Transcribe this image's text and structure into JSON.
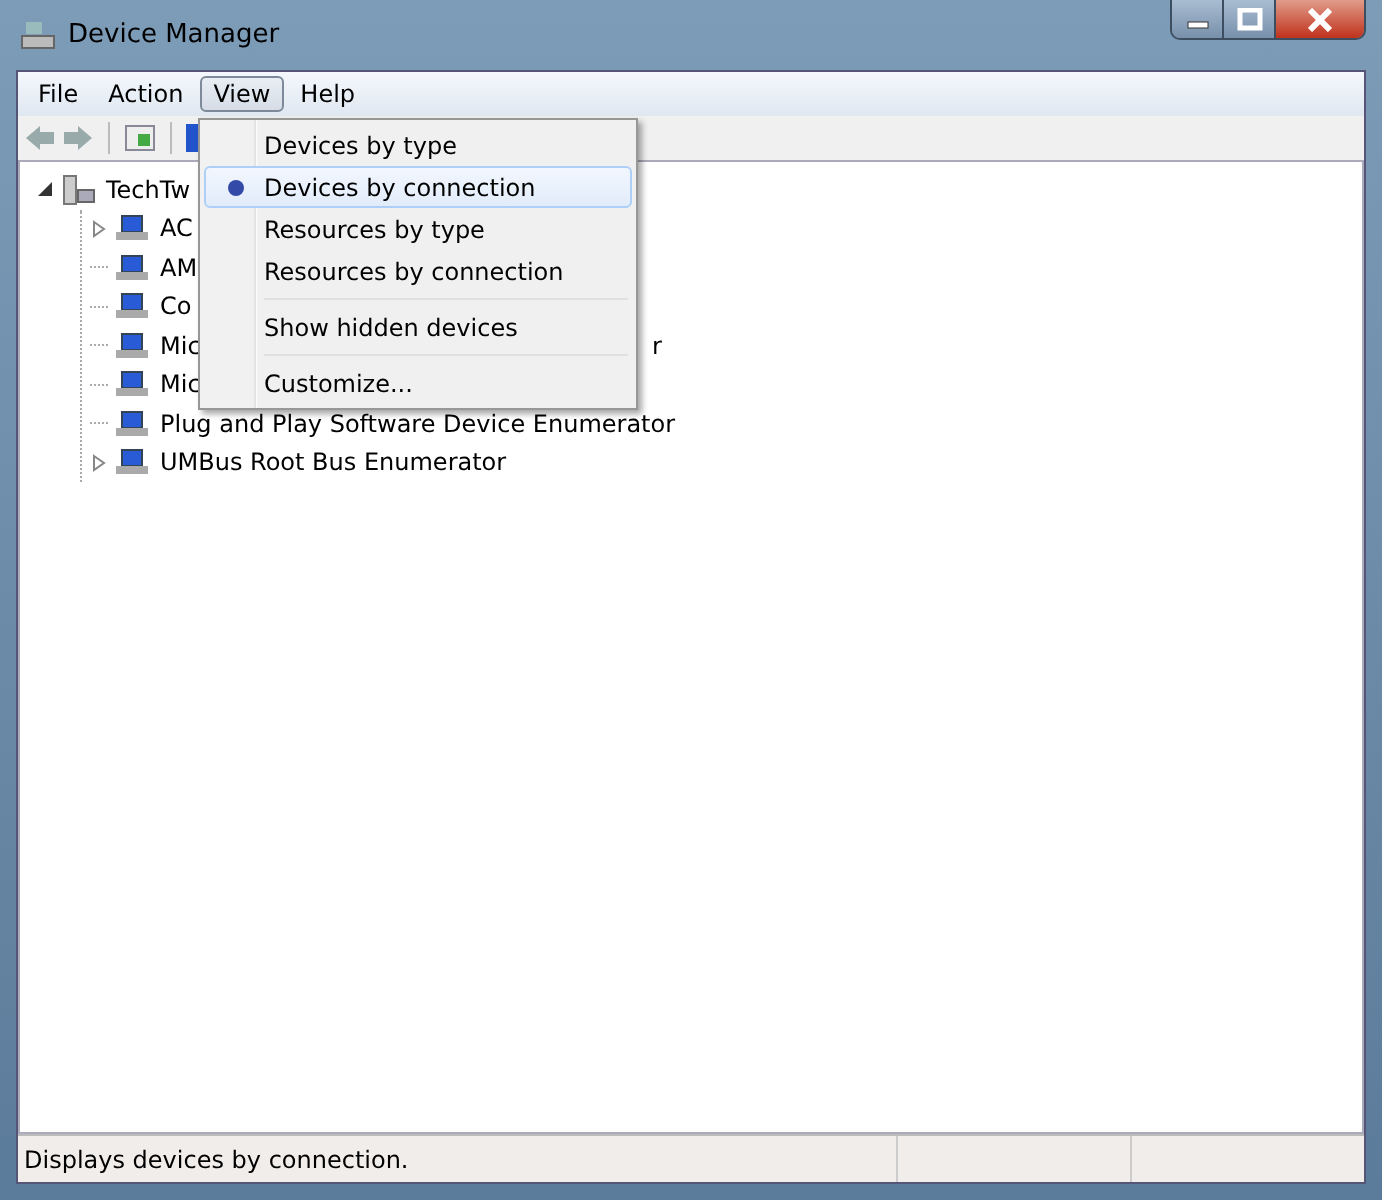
{
  "window": {
    "title": "Device Manager"
  },
  "menu_bar": [
    {
      "label": "File",
      "selected": false
    },
    {
      "label": "Action",
      "selected": false
    },
    {
      "label": "View",
      "selected": true
    },
    {
      "label": "Help",
      "selected": false
    }
  ],
  "tree": {
    "label": "TechTw",
    "expanded": true,
    "children": [
      {
        "label": "AC",
        "expandable": true
      },
      {
        "label": "AM",
        "expandable": false
      },
      {
        "label": "Co",
        "expandable": false
      },
      {
        "label": "Mic",
        "expandable": false,
        "tail": "r"
      },
      {
        "label": "Mic",
        "expandable": false
      },
      {
        "label": "Plug and Play Software Device Enumerator",
        "expandable": false
      },
      {
        "label": "UMBus Root Bus Enumerator",
        "expandable": true
      }
    ]
  },
  "view_menu": [
    {
      "label": "Devices by type",
      "selected": false,
      "separator_before": false
    },
    {
      "label": "Devices by connection",
      "selected": true,
      "separator_before": false
    },
    {
      "label": "Resources by type",
      "selected": false,
      "separator_before": false
    },
    {
      "label": "Resources by connection",
      "selected": false,
      "separator_before": false
    },
    {
      "label": "Show hidden devices",
      "selected": false,
      "separator_before": true
    },
    {
      "label": "Customize...",
      "selected": false,
      "separator_before": true
    }
  ],
  "status_bar": {
    "text": "Displays devices by connection."
  }
}
